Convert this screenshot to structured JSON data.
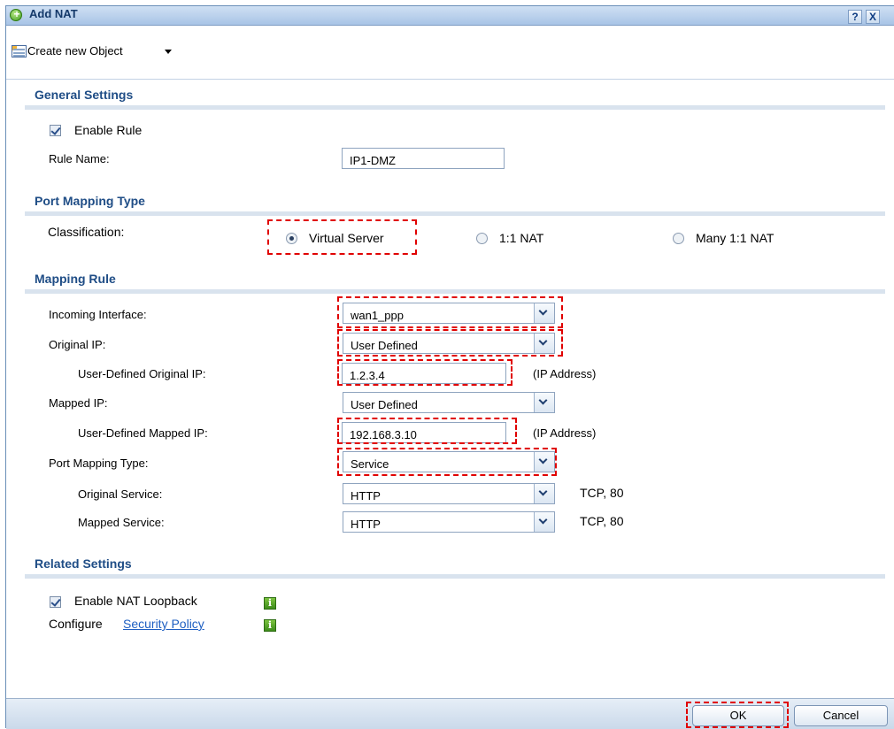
{
  "window": {
    "title": "Add NAT",
    "help_label": "?",
    "close_label": "X"
  },
  "toolbar": {
    "create_label": "Create new Object"
  },
  "general": {
    "title": "General Settings",
    "enable_rule_label": "Enable Rule",
    "enable_rule_checked": true,
    "rule_name_label": "Rule Name:",
    "rule_name_value": "IP1-DMZ"
  },
  "port_mapping_type": {
    "title": "Port Mapping Type",
    "classification_label": "Classification:",
    "options": [
      "Virtual Server",
      "1:1 NAT",
      "Many 1:1 NAT"
    ],
    "selected": "Virtual Server"
  },
  "mapping_rule": {
    "title": "Mapping Rule",
    "incoming_interface_label": "Incoming Interface:",
    "incoming_interface_value": "wan1_ppp",
    "original_ip_label": "Original IP:",
    "original_ip_value": "User Defined",
    "user_defined_original_ip_label": "User-Defined Original IP:",
    "user_defined_original_ip_value": "1.2.3.4",
    "ip_address_hint": "(IP Address)",
    "mapped_ip_label": "Mapped IP:",
    "mapped_ip_value": "User Defined",
    "user_defined_mapped_ip_label": "User-Defined Mapped IP:",
    "user_defined_mapped_ip_value": "192.168.3.10",
    "port_mapping_type_label": "Port Mapping Type:",
    "port_mapping_type_value": "Service",
    "original_service_label": "Original Service:",
    "original_service_value": "HTTP",
    "original_service_detail": "TCP, 80",
    "mapped_service_label": "Mapped Service:",
    "mapped_service_value": "HTTP",
    "mapped_service_detail": "TCP, 80"
  },
  "related": {
    "title": "Related Settings",
    "nat_loopback_label": "Enable NAT Loopback",
    "nat_loopback_checked": true,
    "configure_label": "Configure",
    "security_policy_link": "Security Policy",
    "info_glyph": "i"
  },
  "footer": {
    "ok_label": "OK",
    "cancel_label": "Cancel"
  },
  "colors": {
    "highlight": "#e00000",
    "section_title": "#1f4d86",
    "link": "#1e5fc2"
  }
}
